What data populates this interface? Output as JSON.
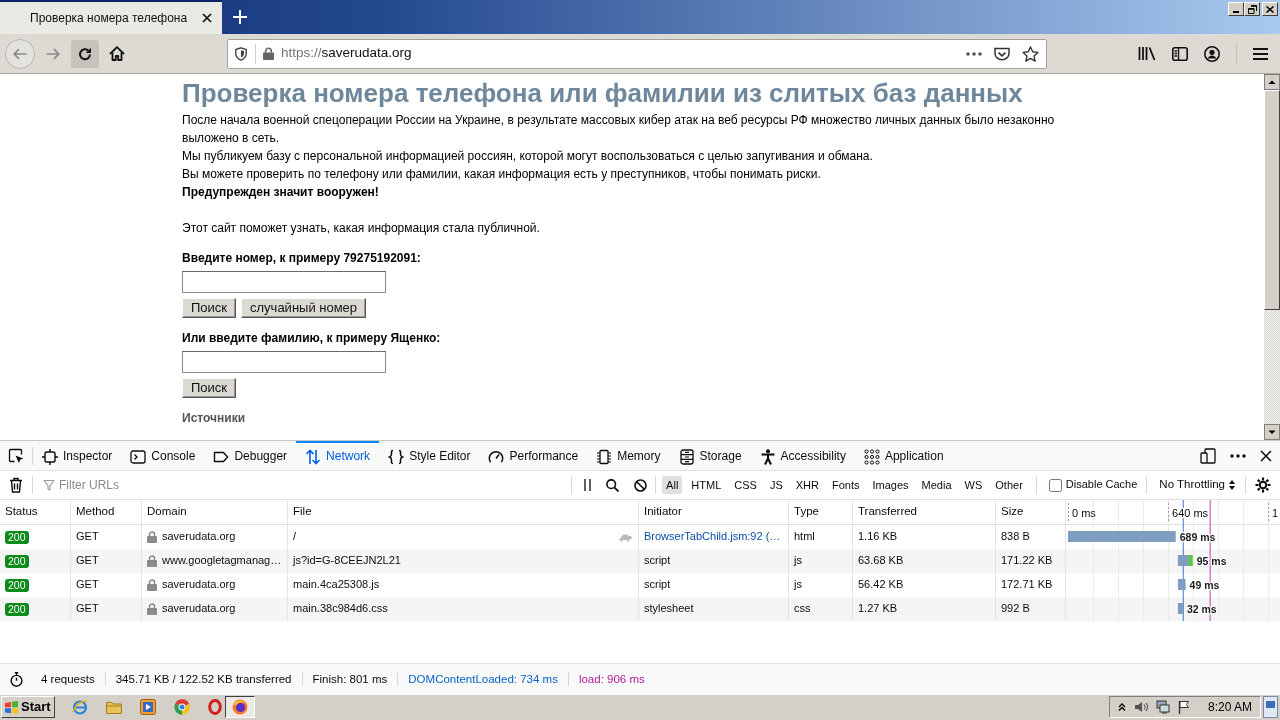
{
  "browser": {
    "tab_title": "Проверка номера телефона",
    "url": {
      "scheme": "https://",
      "host": "saverudata.org"
    }
  },
  "page": {
    "heading": "Проверка номера телефона или фамилии из слитых баз данных",
    "intro": [
      {
        "text": "После начала военной спецоперации России на Украине, в результате массовых кибер атак на веб ресурсы РФ множество личных данных было незаконно выложено в сеть.",
        "bold": false
      },
      {
        "text": "Мы публикуем базу с персональной информацией россиян, которой могут воспользоваться с целью запугивания и обмана.",
        "bold": false
      },
      {
        "text": "Вы можете проверить по телефону или фамилии, какая информация есть у преступников, чтобы понимать риски.",
        "bold": false
      },
      {
        "text": "Предупрежден значит вооружен!",
        "bold": true
      }
    ],
    "note": "Этот сайт поможет узнать, какая информация стала публичной.",
    "forms": [
      {
        "label": "Введите номер, к примеру 79275192091:",
        "buttons": [
          "Поиск",
          "случайный номер"
        ]
      },
      {
        "label": "Или введите фамилию, к примеру Ященко:",
        "buttons": [
          "Поиск"
        ]
      }
    ],
    "sources": "Источники"
  },
  "devtools": {
    "tabs": [
      {
        "label": "Inspector",
        "selected": false
      },
      {
        "label": "Console",
        "selected": false
      },
      {
        "label": "Debugger",
        "selected": false
      },
      {
        "label": "Network",
        "selected": true
      },
      {
        "label": "Style Editor",
        "selected": false
      },
      {
        "label": "Performance",
        "selected": false
      },
      {
        "label": "Memory",
        "selected": false
      },
      {
        "label": "Storage",
        "selected": false
      },
      {
        "label": "Accessibility",
        "selected": false
      },
      {
        "label": "Application",
        "selected": false
      }
    ],
    "filter": {
      "placeholder": "Filter URLs"
    },
    "type_filters": [
      {
        "label": "All",
        "selected": true
      },
      {
        "label": "HTML",
        "selected": false
      },
      {
        "label": "CSS",
        "selected": false
      },
      {
        "label": "JS",
        "selected": false
      },
      {
        "label": "XHR",
        "selected": false
      },
      {
        "label": "Fonts",
        "selected": false
      },
      {
        "label": "Images",
        "selected": false
      },
      {
        "label": "Media",
        "selected": false
      },
      {
        "label": "WS",
        "selected": false
      },
      {
        "label": "Other",
        "selected": false
      }
    ],
    "disable_cache": {
      "label": "Disable Cache",
      "checked": false
    },
    "throttling": "No Throttling",
    "table": {
      "columns": [
        "Status",
        "Method",
        "Domain",
        "File",
        "Initiator",
        "Type",
        "Transferred",
        "Size"
      ],
      "rows": [
        {
          "status": "200",
          "method": "GET",
          "domain": "saverudata.org",
          "file": "/",
          "slow": true,
          "initiator": {
            "text": "BrowserTabChild.jsm:92 (…",
            "link": true
          },
          "type": "html",
          "transferred": "1.16 KB",
          "size": "838 B",
          "timing": "689 ms"
        },
        {
          "status": "200",
          "method": "GET",
          "domain": "www.googletagmanag…",
          "file": "js?id=G-8CEEJN2L21",
          "slow": false,
          "initiator": {
            "text": "script",
            "link": false
          },
          "type": "js",
          "transferred": "63.68 KB",
          "size": "171.22 KB",
          "timing": "95 ms"
        },
        {
          "status": "200",
          "method": "GET",
          "domain": "saverudata.org",
          "file": "main.4ca25308.js",
          "slow": false,
          "initiator": {
            "text": "script",
            "link": false
          },
          "type": "js",
          "transferred": "56.42 KB",
          "size": "172.71 KB",
          "timing": "49 ms"
        },
        {
          "status": "200",
          "method": "GET",
          "domain": "saverudata.org",
          "file": "main.38c984d6.css",
          "slow": false,
          "initiator": {
            "text": "stylesheet",
            "link": false
          },
          "type": "css",
          "transferred": "1.27 KB",
          "size": "992 B",
          "timing": "32 ms"
        }
      ]
    },
    "waterfall": {
      "tick_labels": [
        "0 ms",
        "640 ms",
        "1"
      ]
    },
    "summary": {
      "requests": "4 requests",
      "transferred": "345.71 KB / 122.52 KB transferred",
      "finish": "Finish: 801 ms",
      "dom_content_loaded": "DOMContentLoaded: 734 ms",
      "load": "load: 906 ms"
    }
  },
  "taskbar": {
    "start": "Start",
    "clock": "8:20 AM"
  }
}
